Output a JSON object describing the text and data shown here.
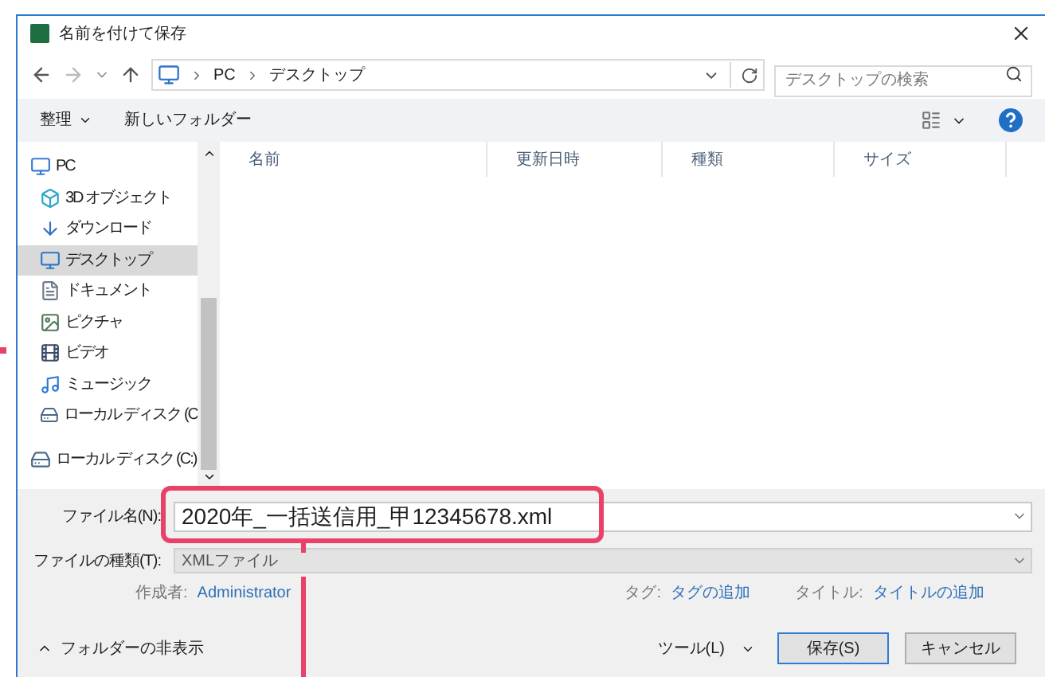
{
  "window": {
    "title": "名前を付けて保存"
  },
  "address_bar": {
    "path": [
      "PC",
      "デスクトップ"
    ]
  },
  "search": {
    "placeholder": "デスクトップの検索"
  },
  "toolbar": {
    "organize": "整理",
    "new_folder": "新しいフォルダー"
  },
  "sidebar": {
    "items": [
      {
        "label": "PC",
        "kind": "pc",
        "selected": false,
        "children": [
          {
            "label": "3D オブジェクト",
            "kind": "cube",
            "selected": false
          },
          {
            "label": "ダウンロード",
            "kind": "download",
            "selected": false
          },
          {
            "label": "デスクトップ",
            "kind": "desktop",
            "selected": true
          },
          {
            "label": "ドキュメント",
            "kind": "document",
            "selected": false
          },
          {
            "label": "ピクチャ",
            "kind": "picture",
            "selected": false
          },
          {
            "label": "ビデオ",
            "kind": "video",
            "selected": false
          },
          {
            "label": "ミュージック",
            "kind": "music",
            "selected": false
          },
          {
            "label": "ローカル ディスク (C",
            "kind": "drive",
            "selected": false
          }
        ]
      },
      {
        "label": "ローカル ディスク (C:)",
        "kind": "drive",
        "selected": false
      }
    ]
  },
  "table": {
    "columns": [
      "名前",
      "更新日時",
      "種類",
      "サイズ"
    ]
  },
  "form": {
    "file_name_label": "ファイル名(N):",
    "file_name": "2020年_一括送信用_甲12345678.xml",
    "file_type_label": "ファイルの種類(T):",
    "file_type": "XMLファイル"
  },
  "metadata": [
    {
      "label": "作成者:",
      "value": "Administrator"
    },
    {
      "label": "タグ:",
      "value": "タグの追加"
    },
    {
      "label": "タイトル:",
      "value": "タイトルの追加"
    }
  ],
  "hide_folders": "フォルダーの非表示",
  "buttons": [
    {
      "label": "ツール(L)",
      "kind": "menu"
    },
    {
      "label": "保存(S)",
      "kind": "primary"
    },
    {
      "label": "キャンセル",
      "kind": "normal"
    }
  ]
}
